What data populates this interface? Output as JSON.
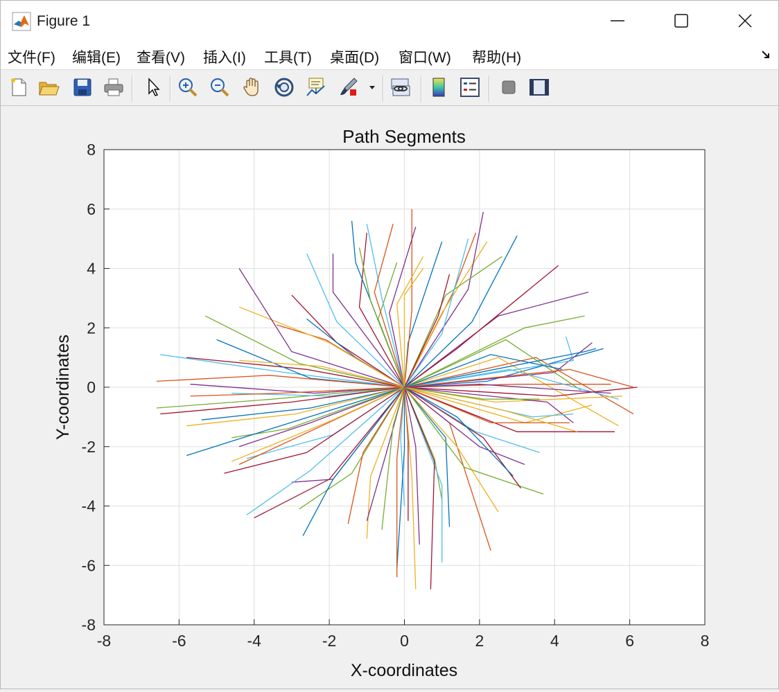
{
  "window": {
    "title": "Figure 1",
    "controls": {
      "minimize": "minimize",
      "maximize": "maximize",
      "close": "close"
    }
  },
  "menu": {
    "items": [
      "文件(F)",
      "编辑(E)",
      "查看(V)",
      "插入(I)",
      "工具(T)",
      "桌面(D)",
      "窗口(W)",
      "帮助(H)"
    ]
  },
  "toolbar": {
    "tools": [
      "new-figure-icon",
      "open-file-icon",
      "save-icon",
      "print-icon",
      "select-arrow-icon",
      "zoom-in-icon",
      "zoom-out-icon",
      "pan-hand-icon",
      "rotate-3d-icon",
      "data-cursor-icon",
      "brush-icon",
      "brush-dropdown-icon",
      "link-plot-icon",
      "colorbar-icon",
      "legend-icon",
      "hide-plot-tools-icon",
      "show-plot-tools-icon"
    ]
  },
  "chart_data": {
    "type": "line",
    "title": "Path Segments",
    "xlabel": "X-coordinates",
    "ylabel": "Y-coordinates",
    "xlim": [
      -8,
      8
    ],
    "ylim": [
      -8,
      8
    ],
    "xticks": [
      -8,
      -6,
      -4,
      -2,
      0,
      2,
      4,
      6,
      8
    ],
    "yticks": [
      -8,
      -6,
      -4,
      -2,
      0,
      2,
      4,
      6,
      8
    ],
    "grid": true,
    "colors": [
      "#0072BD",
      "#D95319",
      "#EDB120",
      "#7E2F8E",
      "#77AC30",
      "#4DBEEE",
      "#A2142F"
    ],
    "segments": [
      [
        [
          0,
          0
        ],
        [
          2.2,
          0.2
        ],
        [
          5.3,
          1.3
        ]
      ],
      [
        [
          0,
          0
        ],
        [
          3.5,
          1.0
        ],
        [
          6.1,
          -0.9
        ]
      ],
      [
        [
          0,
          0
        ],
        [
          2.5,
          1.0
        ],
        [
          5.7,
          -1.3
        ]
      ],
      [
        [
          0,
          0
        ],
        [
          4.0,
          0.5
        ],
        [
          5.0,
          1.5
        ]
      ],
      [
        [
          0,
          0
        ],
        [
          2.7,
          1.6
        ],
        [
          4.7,
          -0.1
        ]
      ],
      [
        [
          0,
          0
        ],
        [
          4.5,
          0.9
        ],
        [
          4.3,
          1.7
        ]
      ],
      [
        [
          0,
          0
        ],
        [
          4.0,
          -0.3
        ],
        [
          6.2,
          0.0
        ]
      ],
      [
        [
          0,
          0
        ],
        [
          2.3,
          1.1
        ],
        [
          4.2,
          0.6
        ]
      ],
      [
        [
          0,
          0
        ],
        [
          3.0,
          0.1
        ],
        [
          5.5,
          0.1
        ]
      ],
      [
        [
          0,
          0
        ],
        [
          3.2,
          -1.2
        ],
        [
          5.0,
          -0.6
        ]
      ],
      [
        [
          0,
          0
        ],
        [
          2.5,
          2.4
        ],
        [
          4.9,
          3.2
        ]
      ],
      [
        [
          0,
          0
        ],
        [
          3.2,
          2.0
        ],
        [
          4.8,
          2.4
        ]
      ],
      [
        [
          0,
          0
        ],
        [
          2.8,
          0.6
        ],
        [
          5.7,
          -0.4
        ]
      ],
      [
        [
          0,
          0
        ],
        [
          3.0,
          -1.5
        ],
        [
          5.6,
          -1.5
        ]
      ],
      [
        [
          0,
          0
        ],
        [
          4.8,
          1.2
        ],
        [
          5.1,
          1.3
        ]
      ],
      [
        [
          0,
          0
        ],
        [
          4.4,
          0.6
        ],
        [
          6.1,
          0.0
        ]
      ],
      [
        [
          0,
          0
        ],
        [
          2.4,
          -0.5
        ],
        [
          5.8,
          -0.3
        ]
      ],
      [
        [
          0,
          0
        ],
        [
          3.8,
          -0.5
        ],
        [
          4.5,
          -1.2
        ]
      ],
      [
        [
          0,
          0
        ],
        [
          2.1,
          -0.4
        ],
        [
          3.6,
          -0.4
        ]
      ],
      [
        [
          0,
          0
        ],
        [
          3.4,
          -1.0
        ],
        [
          4.5,
          -0.9
        ]
      ],
      [
        [
          0,
          0
        ],
        [
          1.4,
          1.3
        ],
        [
          4.1,
          4.1
        ]
      ],
      [
        [
          0,
          0
        ],
        [
          1.8,
          2.2
        ],
        [
          3.0,
          5.1
        ]
      ],
      [
        [
          0,
          0
        ],
        [
          1.3,
          3.2
        ],
        [
          1.9,
          5.2
        ]
      ],
      [
        [
          0,
          0
        ],
        [
          1.0,
          2.5
        ],
        [
          2.2,
          4.9
        ]
      ],
      [
        [
          0,
          0
        ],
        [
          1.7,
          3.3
        ],
        [
          2.1,
          5.9
        ]
      ],
      [
        [
          0,
          0
        ],
        [
          1.1,
          3.1
        ],
        [
          2.6,
          4.4
        ]
      ],
      [
        [
          0,
          0
        ],
        [
          1.0,
          1.8
        ],
        [
          1.7,
          5.0
        ]
      ],
      [
        [
          0,
          0
        ],
        [
          0.9,
          2.4
        ],
        [
          1.2,
          3.8
        ]
      ],
      [
        [
          0,
          0
        ],
        [
          0.1,
          1.5
        ],
        [
          1.0,
          4.9
        ]
      ],
      [
        [
          0,
          0
        ],
        [
          0.2,
          2.6
        ],
        [
          0.2,
          6.0
        ]
      ],
      [
        [
          0,
          0
        ],
        [
          0.0,
          3.1
        ],
        [
          0.5,
          4.0
        ]
      ],
      [
        [
          0,
          0
        ],
        [
          -0.4,
          2.5
        ],
        [
          0.3,
          5.4
        ]
      ],
      [
        [
          0,
          0
        ],
        [
          -0.7,
          2.3
        ],
        [
          -0.2,
          4.2
        ]
      ],
      [
        [
          0,
          0
        ],
        [
          -0.6,
          3.0
        ],
        [
          -1.0,
          5.5
        ]
      ],
      [
        [
          0,
          0
        ],
        [
          -1.2,
          2.7
        ],
        [
          -1.0,
          5.2
        ]
      ],
      [
        [
          0,
          0
        ],
        [
          -1.3,
          4.2
        ],
        [
          -1.4,
          5.6
        ]
      ],
      [
        [
          0,
          0
        ],
        [
          -0.8,
          3.2
        ],
        [
          -0.3,
          5.5
        ]
      ],
      [
        [
          0,
          0
        ],
        [
          -0.2,
          2.8
        ],
        [
          0.5,
          4.4
        ]
      ],
      [
        [
          0,
          0
        ],
        [
          -1.9,
          3.2
        ],
        [
          -1.9,
          4.5
        ]
      ],
      [
        [
          0,
          0
        ],
        [
          -0.9,
          2.9
        ],
        [
          -1.2,
          4.7
        ]
      ],
      [
        [
          0,
          0
        ],
        [
          -1.8,
          2.2
        ],
        [
          -2.6,
          4.5
        ]
      ],
      [
        [
          0,
          0
        ],
        [
          -1.8,
          1.5
        ],
        [
          -3.0,
          3.1
        ]
      ],
      [
        [
          0,
          0
        ],
        [
          -1.3,
          1.0
        ],
        [
          -2.6,
          2.3
        ]
      ],
      [
        [
          0,
          0
        ],
        [
          -2.1,
          1.6
        ],
        [
          -3.4,
          2.1
        ]
      ],
      [
        [
          0,
          0
        ],
        [
          -2.0,
          1.5
        ],
        [
          -4.4,
          2.7
        ]
      ],
      [
        [
          0,
          0
        ],
        [
          -3.0,
          1.2
        ],
        [
          -4.4,
          4.0
        ]
      ],
      [
        [
          0,
          0
        ],
        [
          -2.8,
          0.8
        ],
        [
          -5.3,
          2.4
        ]
      ],
      [
        [
          0,
          0
        ],
        [
          -3.2,
          0.5
        ],
        [
          -6.5,
          1.1
        ]
      ],
      [
        [
          0,
          0
        ],
        [
          -2.6,
          0.6
        ],
        [
          -5.8,
          1.0
        ]
      ],
      [
        [
          0,
          0
        ],
        [
          -2.5,
          0.3
        ],
        [
          -5.0,
          1.6
        ]
      ],
      [
        [
          0,
          0
        ],
        [
          -3.6,
          0.4
        ],
        [
          -6.6,
          0.2
        ]
      ],
      [
        [
          0,
          0
        ],
        [
          -2.2,
          0.7
        ],
        [
          -4.4,
          0.9
        ]
      ],
      [
        [
          0,
          0
        ],
        [
          -2.4,
          -0.2
        ],
        [
          -5.7,
          0.1
        ]
      ],
      [
        [
          0,
          0
        ],
        [
          -3.5,
          -0.4
        ],
        [
          -6.6,
          -0.7
        ]
      ],
      [
        [
          0,
          0
        ],
        [
          -2.0,
          -0.3
        ],
        [
          -4.6,
          -0.2
        ]
      ],
      [
        [
          0,
          0
        ],
        [
          -3.0,
          -0.5
        ],
        [
          -6.5,
          -0.9
        ]
      ],
      [
        [
          0,
          0
        ],
        [
          -2.5,
          -0.7
        ],
        [
          -5.4,
          -1.1
        ]
      ],
      [
        [
          0,
          0
        ],
        [
          -3.3,
          -0.2
        ],
        [
          -5.7,
          -0.3
        ]
      ],
      [
        [
          0,
          0
        ],
        [
          -2.9,
          -0.9
        ],
        [
          -5.8,
          -1.3
        ]
      ],
      [
        [
          0,
          0
        ],
        [
          -2.5,
          -1.2
        ],
        [
          -4.4,
          -2.0
        ]
      ],
      [
        [
          0,
          0
        ],
        [
          -3.1,
          -1.4
        ],
        [
          -4.6,
          -1.7
        ]
      ],
      [
        [
          0,
          0
        ],
        [
          -1.9,
          -1.6
        ],
        [
          -4.2,
          -2.4
        ]
      ],
      [
        [
          0,
          0
        ],
        [
          -2.6,
          -2.2
        ],
        [
          -4.8,
          -2.9
        ]
      ],
      [
        [
          0,
          0
        ],
        [
          -3.3,
          -1.3
        ],
        [
          -5.8,
          -2.3
        ]
      ],
      [
        [
          0,
          0
        ],
        [
          -2.2,
          -1.3
        ],
        [
          -4.4,
          -2.6
        ]
      ],
      [
        [
          0,
          0
        ],
        [
          -1.9,
          -1.1
        ],
        [
          -4.6,
          -2.5
        ]
      ],
      [
        [
          0,
          0
        ],
        [
          -1.9,
          -3.1
        ],
        [
          -3.0,
          -3.2
        ]
      ],
      [
        [
          0,
          0
        ],
        [
          -1.4,
          -2.9
        ],
        [
          -2.8,
          -4.1
        ]
      ],
      [
        [
          0,
          0
        ],
        [
          -2.5,
          -2.8
        ],
        [
          -4.2,
          -4.3
        ]
      ],
      [
        [
          0,
          0
        ],
        [
          -2.0,
          -3.1
        ],
        [
          -4.0,
          -4.4
        ]
      ],
      [
        [
          0,
          0
        ],
        [
          -1.9,
          -3.1
        ],
        [
          -2.7,
          -5.0
        ]
      ],
      [
        [
          0,
          0
        ],
        [
          -1.1,
          -2.2
        ],
        [
          -1.5,
          -4.6
        ]
      ],
      [
        [
          0,
          0
        ],
        [
          -0.9,
          -3.0
        ],
        [
          -1.0,
          -5.1
        ]
      ],
      [
        [
          0,
          0
        ],
        [
          -0.5,
          -2.3
        ],
        [
          -1.0,
          -4.5
        ]
      ],
      [
        [
          0,
          0
        ],
        [
          -0.3,
          -1.3
        ],
        [
          -0.6,
          -4.8
        ]
      ],
      [
        [
          0,
          0
        ],
        [
          -0.1,
          -1.7
        ],
        [
          0.0,
          -4.0
        ]
      ],
      [
        [
          0,
          0
        ],
        [
          0.1,
          -1.8
        ],
        [
          0.1,
          -4.5
        ]
      ],
      [
        [
          0,
          0
        ],
        [
          0.0,
          -2.1
        ],
        [
          -0.2,
          -6.1
        ]
      ],
      [
        [
          0,
          0
        ],
        [
          -0.2,
          -2.4
        ],
        [
          -0.2,
          -6.4
        ]
      ],
      [
        [
          0,
          0
        ],
        [
          0.2,
          -3.0
        ],
        [
          0.3,
          -6.8
        ]
      ],
      [
        [
          0,
          0
        ],
        [
          0.3,
          -2.0
        ],
        [
          0.4,
          -5.3
        ]
      ],
      [
        [
          0,
          0
        ],
        [
          0.8,
          -2.4
        ],
        [
          1.0,
          -3.8
        ]
      ],
      [
        [
          0,
          0
        ],
        [
          1.0,
          -3.3
        ],
        [
          1.0,
          -5.9
        ]
      ],
      [
        [
          0,
          0
        ],
        [
          0.8,
          -2.5
        ],
        [
          0.7,
          -6.8
        ]
      ],
      [
        [
          0,
          0
        ],
        [
          1.1,
          -1.7
        ],
        [
          1.2,
          -4.7
        ]
      ],
      [
        [
          0,
          0
        ],
        [
          1.2,
          -1.2
        ],
        [
          2.3,
          -5.5
        ]
      ],
      [
        [
          0,
          0
        ],
        [
          1.4,
          -2.0
        ],
        [
          2.5,
          -4.2
        ]
      ],
      [
        [
          0,
          0
        ],
        [
          2.0,
          -2.0
        ],
        [
          3.2,
          -2.6
        ]
      ],
      [
        [
          0,
          0
        ],
        [
          1.6,
          -2.7
        ],
        [
          3.7,
          -3.6
        ]
      ],
      [
        [
          0,
          0
        ],
        [
          1.9,
          -1.5
        ],
        [
          3.6,
          -2.2
        ]
      ],
      [
        [
          0,
          0
        ],
        [
          2.1,
          -1.7
        ],
        [
          3.1,
          -3.4
        ]
      ],
      [
        [
          0,
          0
        ],
        [
          1.4,
          -1.0
        ],
        [
          2.9,
          -3.0
        ]
      ],
      [
        [
          0,
          0
        ],
        [
          2.3,
          -1.2
        ],
        [
          4.4,
          -1.2
        ]
      ],
      [
        [
          0,
          0
        ],
        [
          2.7,
          -0.8
        ],
        [
          4.6,
          -1.5
        ]
      ],
      [
        [
          0,
          0
        ],
        [
          2.0,
          0.1
        ],
        [
          5.5,
          -0.2
        ]
      ]
    ]
  }
}
